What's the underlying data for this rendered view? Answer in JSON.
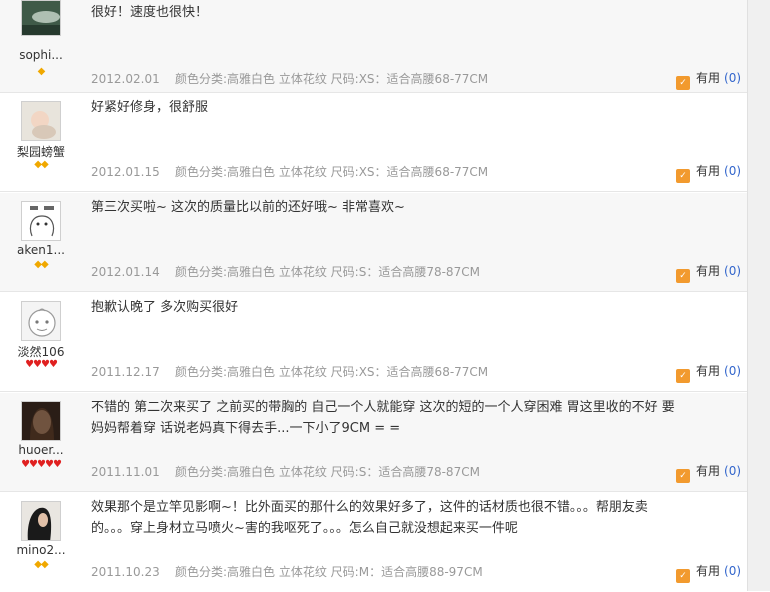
{
  "useful_label": "有用",
  "reviews": [
    {
      "user": "sophi...",
      "rank": "◆",
      "content": "很好！速度也很快！",
      "date": "2012.02.01",
      "sku": "颜色分类:高雅白色 立体花纹   尺码:XS：适合高腰68-77CM",
      "useful_count": "(0)"
    },
    {
      "user": "梨园螃蟹",
      "rank": "◆◆",
      "content": "好紧好修身，很舒服",
      "date": "2012.01.15",
      "sku": "颜色分类:高雅白色 立体花纹   尺码:XS：适合高腰68-77CM",
      "useful_count": "(0)"
    },
    {
      "user": "aken1...",
      "rank": "◆◆",
      "content": "第三次买啦~ 这次的质量比以前的还好哦~ 非常喜欢~",
      "date": "2012.01.14",
      "sku": "颜色分类:高雅白色 立体花纹   尺码:S：适合高腰78-87CM",
      "useful_count": "(0)"
    },
    {
      "user": "淡然106",
      "rank": "♥♥♥♥",
      "content": "抱歉认晚了 多次购买很好",
      "date": "2011.12.17",
      "sku": "颜色分类:高雅白色 立体花纹   尺码:XS：适合高腰68-77CM",
      "useful_count": "(0)"
    },
    {
      "user": "huoer...",
      "rank": "♥♥♥♥♥",
      "content": "不错的 第二次来买了 之前买的带胸的 自己一个人就能穿 这次的短的一个人穿困难 胃这里收的不好 要妈妈帮着穿 话说老妈真下得去手...一下小了9CM = =",
      "date": "2011.11.01",
      "sku": "颜色分类:高雅白色 立体花纹   尺码:S：适合高腰78-87CM",
      "useful_count": "(0)"
    },
    {
      "user": "mino2...",
      "rank": "◆◆",
      "content": "效果那个是立竿见影啊~！比外面买的那什么的效果好多了，这件的话材质也很不错。。。帮朋友卖的。。。穿上身材立马喷火~害的我呕死了。。。怎么自己就没想起来买一件呢",
      "date": "2011.10.23",
      "sku": "颜色分类:高雅白色 立体花纹   尺码:M：适合高腰88-97CM",
      "useful_count": "(0)"
    }
  ]
}
